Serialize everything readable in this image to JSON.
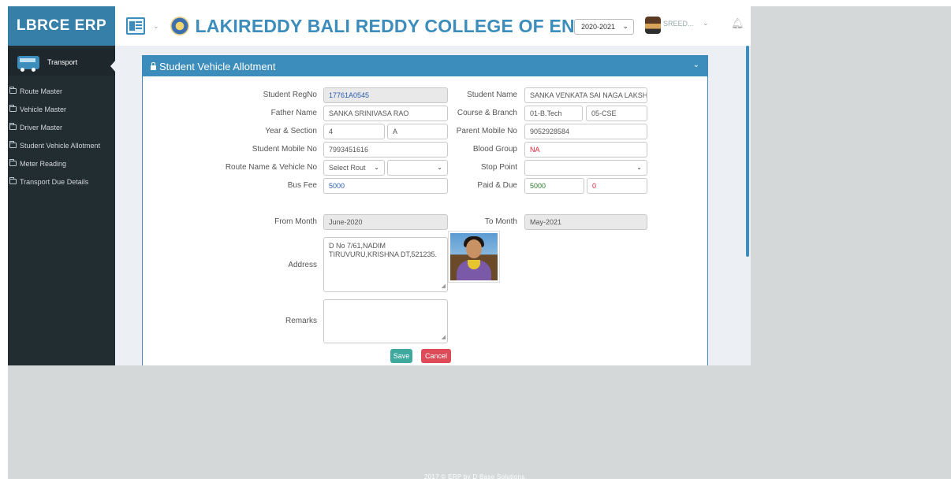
{
  "brand": "LBRCE ERP",
  "college_name": "LAKIREDDY BALI REDDY COLLEGE OF ENGG",
  "academic_year": "2020-2021",
  "user_name": "SREED...",
  "sidebar": {
    "module": "Transport",
    "items": [
      {
        "label": "Route Master"
      },
      {
        "label": "Vehicle Master"
      },
      {
        "label": "Driver Master"
      },
      {
        "label": "Student Vehicle Allotment"
      },
      {
        "label": "Meter Reading"
      },
      {
        "label": "Transport Due Details"
      }
    ]
  },
  "panel_title": "Student Vehicle Allotment",
  "form": {
    "labels": {
      "reg_no": "Student RegNo",
      "student_name": "Student Name",
      "father_name": "Father Name",
      "course_branch": "Course & Branch",
      "year_section": "Year & Section",
      "parent_mobile": "Parent Mobile No",
      "student_mobile": "Student Mobile No",
      "blood_group": "Blood Group",
      "route_vehicle": "Route Name & Vehicle No",
      "stop_point": "Stop Point",
      "bus_fee": "Bus Fee",
      "paid_due": "Paid & Due",
      "from_month": "From Month",
      "to_month": "To Month",
      "address": "Address",
      "remarks": "Remarks"
    },
    "values": {
      "reg_no": "17761A0545",
      "student_name": "SANKA VENKATA SAI NAGA LAKSH",
      "father_name": "SANKA SRINIVASA RAO",
      "course": "01-B.Tech",
      "branch": "05-CSE",
      "year": "4",
      "section": "A",
      "parent_mobile": "9052928584",
      "student_mobile": "7993451616",
      "blood_group": "NA",
      "route_select": "Select Rout",
      "vehicle_select": "",
      "stop_point": "",
      "bus_fee": "5000",
      "paid": "5000",
      "due": "0",
      "from_month": "June-2020",
      "to_month": "May-2021",
      "address": "D No 7/61,NADIM TIRUVURU,KRISHNA DT,521235.",
      "remarks": ""
    }
  },
  "buttons": {
    "save": "Save",
    "cancel": "Cancel"
  },
  "footer": "2017 © ERP by D Base Solutions."
}
